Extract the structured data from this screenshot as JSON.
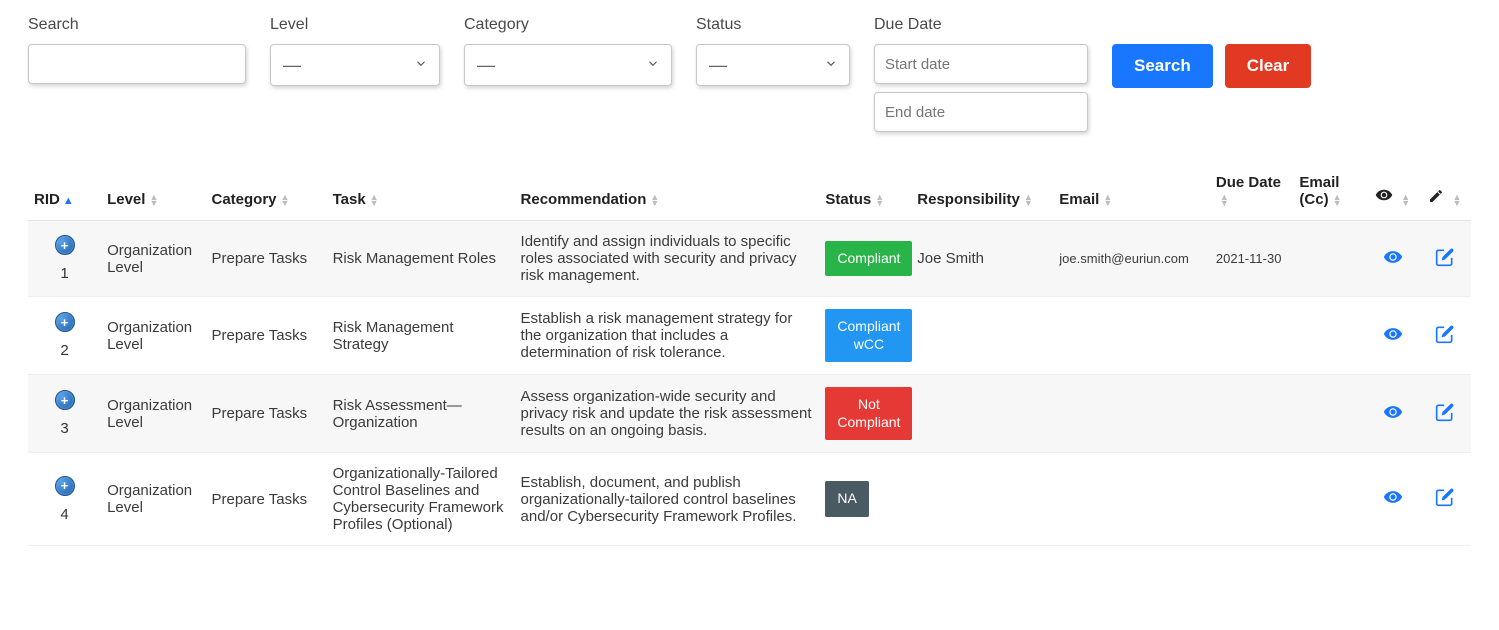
{
  "filters": {
    "search_label": "Search",
    "search_value": "",
    "level_label": "Level",
    "level_value": "—",
    "category_label": "Category",
    "category_value": "—",
    "status_label": "Status",
    "status_value": "—",
    "duedate_label": "Due Date",
    "start_placeholder": "Start date",
    "end_placeholder": "End date",
    "search_button": "Search",
    "clear_button": "Clear"
  },
  "columns": {
    "rid": "RID",
    "level": "Level",
    "category": "Category",
    "task": "Task",
    "recommendation": "Recommendation",
    "status": "Status",
    "responsibility": "Responsibility",
    "email": "Email",
    "due_date": "Due Date",
    "email_cc": "Email (Cc)"
  },
  "status_colors": {
    "Compliant": "badge-green",
    "Compliant wCC": "badge-blue",
    "Not Compliant": "badge-red",
    "NA": "badge-gray"
  },
  "rows": [
    {
      "rid": "1",
      "level": "Organization Level",
      "category": "Prepare Tasks",
      "task": "Risk Management Roles",
      "recommendation": "Identify and assign individuals to specific roles associated with security and privacy risk management.",
      "status": "Compliant",
      "responsibility": "Joe Smith",
      "email": "joe.smith@euriun.com",
      "due_date": "2021-11-30",
      "email_cc": ""
    },
    {
      "rid": "2",
      "level": "Organization Level",
      "category": "Prepare Tasks",
      "task": "Risk Management Strategy",
      "recommendation": "Establish a risk management strategy for the organization that includes a determination of risk tolerance.",
      "status": "Compliant wCC",
      "responsibility": "",
      "email": "",
      "due_date": "",
      "email_cc": ""
    },
    {
      "rid": "3",
      "level": "Organization Level",
      "category": "Prepare Tasks",
      "task": "Risk Assessment—Organization",
      "recommendation": "Assess organization-wide security and privacy risk and update the risk assessment results on an ongoing basis.",
      "status": "Not Compliant",
      "responsibility": "",
      "email": "",
      "due_date": "",
      "email_cc": ""
    },
    {
      "rid": "4",
      "level": "Organization Level",
      "category": "Prepare Tasks",
      "task": "Organizationally-Tailored Control Baselines and Cybersecurity Framework Profiles (Optional)",
      "recommendation": "Establish, document, and publish organizationally-tailored control baselines and/or Cybersecurity Framework Profiles.",
      "status": "NA",
      "responsibility": "",
      "email": "",
      "due_date": "",
      "email_cc": ""
    }
  ]
}
